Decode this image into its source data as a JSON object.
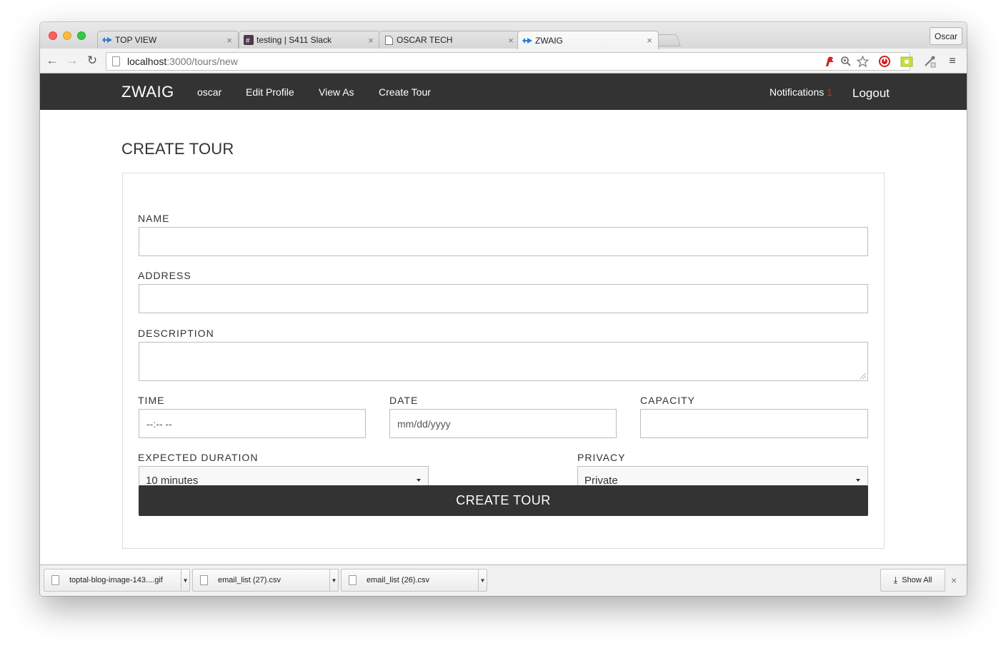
{
  "browser": {
    "tabs": [
      {
        "title": "TOP VIEW",
        "icon": "zwaig-favicon"
      },
      {
        "title": "testing | S411 Slack",
        "icon": "slack-favicon"
      },
      {
        "title": "OSCAR TECH",
        "icon": "page-favicon"
      },
      {
        "title": "ZWAIG",
        "icon": "zwaig-favicon",
        "active": true
      }
    ],
    "profile_name": "Oscar",
    "url_host": "localhost",
    "url_path": ":3000/tours/new"
  },
  "navbar": {
    "brand": "ZWAIG",
    "links": [
      "oscar",
      "Edit Profile",
      "View As",
      "Create Tour"
    ],
    "notifications_label": "Notifications",
    "notifications_count": "1",
    "logout_label": "Logout"
  },
  "page": {
    "title": "CREATE TOUR"
  },
  "form": {
    "name_label": "NAME",
    "name_value": "",
    "address_label": "ADDRESS",
    "address_value": "",
    "description_label": "DESCRIPTION",
    "description_value": "",
    "time_label": "TIME",
    "time_placeholder": "--:-- --",
    "date_label": "DATE",
    "date_placeholder": "mm/dd/yyyy",
    "capacity_label": "CAPACITY",
    "capacity_value": "",
    "duration_label": "EXPECTED DURATION",
    "duration_selected": "10 minutes",
    "privacy_label": "PRIVACY",
    "privacy_selected": "Private",
    "submit_label": "CREATE TOUR"
  },
  "downloads": {
    "items": [
      {
        "name": "toptal-blog-image-143....gif"
      },
      {
        "name": "email_list (27).csv"
      },
      {
        "name": "email_list (26).csv"
      }
    ],
    "show_all_label": "Show All"
  },
  "colors": {
    "navbar_bg": "#333333",
    "button_bg": "#333333",
    "notification_count": "#e02020"
  }
}
